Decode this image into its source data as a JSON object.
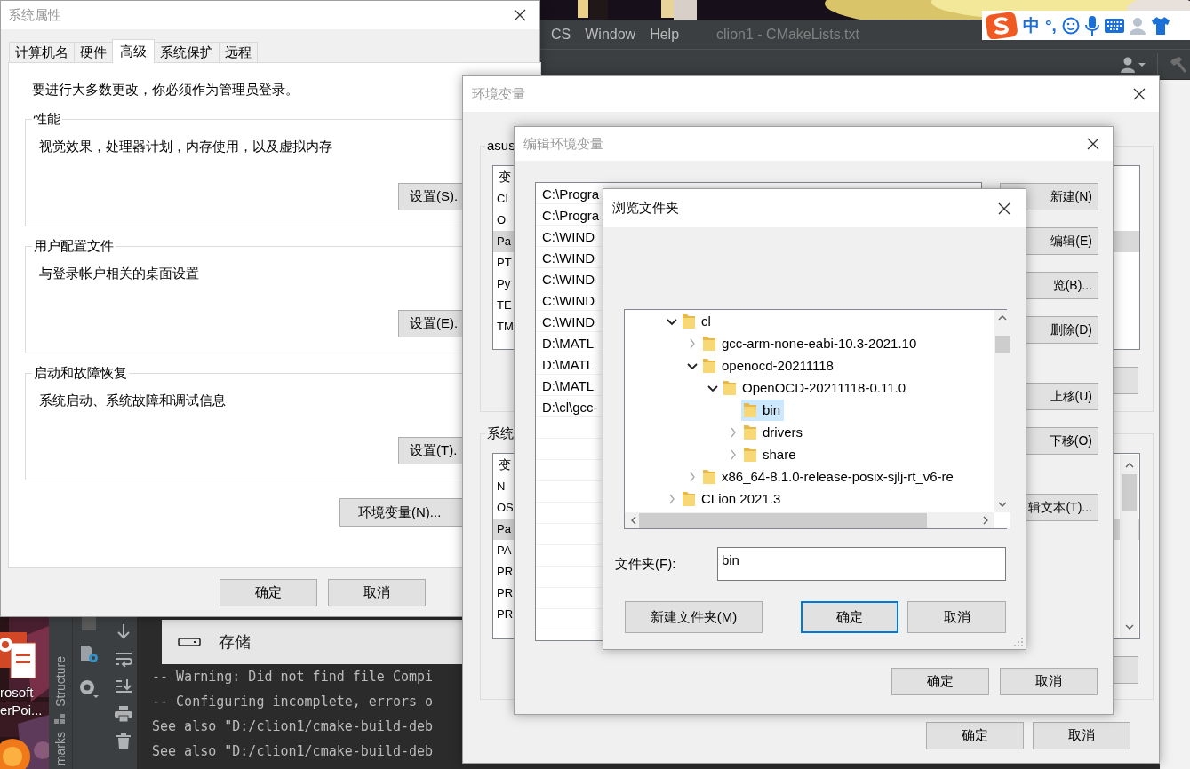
{
  "desktop": {
    "icon_label": "rosoft\nerPoi..."
  },
  "ide": {
    "menu": [
      {
        "label": "CS"
      },
      {
        "label": "Window"
      },
      {
        "label": "Help"
      }
    ],
    "title": "clion1 - CMakeLists.txt",
    "side_tabs": [
      {
        "label": "Structure"
      },
      {
        "label": "marks"
      }
    ],
    "popup": {
      "label": "存储"
    },
    "console_lines": [
      "-- Warning: Did not find file Compi",
      "-- Configuring incomplete, errors o",
      "See also \"D:/clion1/cmake-build-deb",
      "See also \"D:/clion1/cmake-build-deb"
    ]
  },
  "ime_bar": {
    "mode": "中",
    "punctuation": "°,"
  },
  "system_properties": {
    "title": "系统属性",
    "tabs": [
      {
        "label": "计算机名",
        "selected": false
      },
      {
        "label": "硬件",
        "selected": false
      },
      {
        "label": "高级",
        "selected": true
      },
      {
        "label": "系统保护",
        "selected": false
      },
      {
        "label": "远程",
        "selected": false
      }
    ],
    "notice": "要进行大多数更改，你必须作为管理员登录。",
    "groups": [
      {
        "title": "性能",
        "description": "视觉效果，处理器计划，内存使用，以及虚拟内存",
        "button": "设置(S)."
      },
      {
        "title": "用户配置文件",
        "description": "与登录帐户相关的桌面设置",
        "button": "设置(E)."
      },
      {
        "title": "启动和故障恢复",
        "description": "系统启动、系统故障和调试信息",
        "button": "设置(T)."
      }
    ],
    "env_button": "环境变量(N)...",
    "buttons": [
      "确定",
      "取消"
    ]
  },
  "environment_variables": {
    "title": "环境变量",
    "user_group": {
      "title": "asus",
      "header": "变",
      "rows": [
        {
          "text": "CL",
          "selected": false
        },
        {
          "text": "O",
          "selected": false
        },
        {
          "text": "Pa",
          "selected": true
        },
        {
          "text": "PT",
          "selected": false
        },
        {
          "text": "Py",
          "selected": false
        },
        {
          "text": "TE",
          "selected": false
        },
        {
          "text": "TM",
          "selected": false
        }
      ]
    },
    "system_group": {
      "title": "系统",
      "header": "变",
      "rows": [
        {
          "text": "N",
          "selected": false
        },
        {
          "text": "OS",
          "selected": false
        },
        {
          "text": "Pa",
          "selected": true
        },
        {
          "text": "PA",
          "selected": false
        },
        {
          "text": "PR",
          "selected": false
        },
        {
          "text": "PR",
          "selected": false
        },
        {
          "text": "PR",
          "selected": false
        }
      ]
    },
    "buttons": [
      "确定",
      "取消"
    ]
  },
  "edit_variable": {
    "title": "编辑环境变量",
    "entries": [
      "C:\\Progra",
      "C:\\Progra",
      "C:\\WIND",
      "C:\\WIND",
      "C:\\WIND",
      "C:\\WIND",
      "C:\\WIND",
      "D:\\MATL",
      "D:\\MATL",
      "D:\\MATL",
      "D:\\cl\\gcc-"
    ],
    "side_buttons": [
      "新建(N)",
      "编辑(E)",
      "览(B)...",
      "删除(D)",
      "上移(U)",
      "下移(O)",
      "辑文本(T)..."
    ],
    "buttons": [
      "确定",
      "取消"
    ]
  },
  "browse_folder": {
    "title": "浏览文件夹",
    "tree": [
      {
        "label": "cl",
        "expandable": true,
        "expanded": true,
        "selected": false,
        "children": [
          {
            "label": "gcc-arm-none-eabi-10.3-2021.10",
            "expandable": true,
            "expanded": false,
            "selected": false
          },
          {
            "label": "openocd-20211118",
            "expandable": true,
            "expanded": true,
            "selected": false,
            "children": [
              {
                "label": "OpenOCD-20211118-0.11.0",
                "expandable": true,
                "expanded": true,
                "selected": false,
                "children": [
                  {
                    "label": "bin",
                    "expandable": false,
                    "expanded": false,
                    "selected": true
                  },
                  {
                    "label": "drivers",
                    "expandable": true,
                    "expanded": false,
                    "selected": false
                  },
                  {
                    "label": "share",
                    "expandable": true,
                    "expanded": false,
                    "selected": false
                  }
                ]
              }
            ]
          },
          {
            "label": "x86_64-8.1.0-release-posix-sjlj-rt_v6-re",
            "expandable": true,
            "expanded": false,
            "selected": false
          }
        ]
      },
      {
        "label": "CLion 2021.3",
        "expandable": true,
        "expanded": false,
        "selected": false
      }
    ],
    "folder_label": "文件夹(F):",
    "folder_value": "bin",
    "buttons": [
      {
        "label": "新建文件夹(M)",
        "focused": false
      },
      {
        "label": "确定",
        "focused": true
      },
      {
        "label": "取消",
        "focused": false
      }
    ]
  }
}
